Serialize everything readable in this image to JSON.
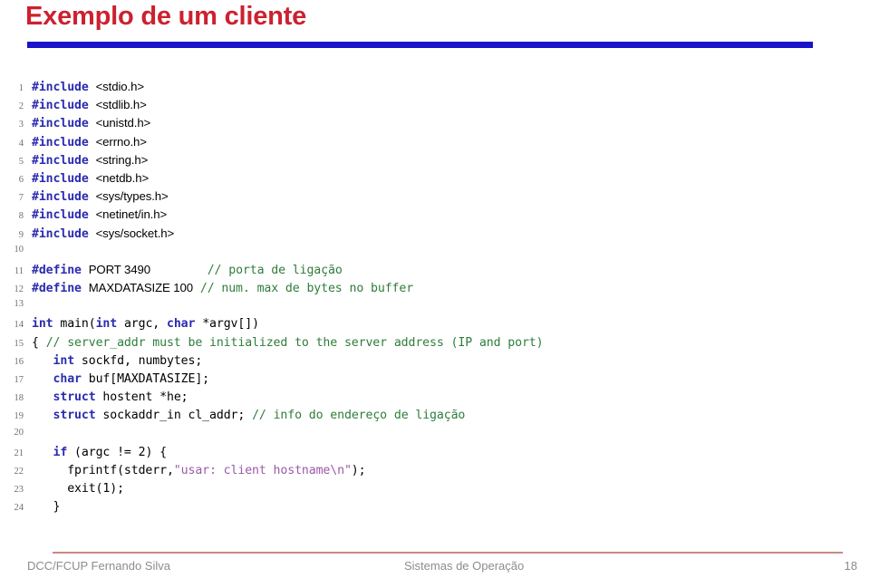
{
  "slide": {
    "title": "Exemplo de um cliente",
    "accent_title_color": "#cc2130",
    "accent_rule_color": "#1a13c8",
    "footer_rule_color": "#c98a83"
  },
  "code": {
    "language": "C",
    "syntax_colors": {
      "keyword": "#2b2bb0",
      "preprocessor": "#2b2bb0",
      "comment": "#2e7d3a",
      "string": "#9a5aa8",
      "plain": "#000000",
      "lineno": "#6f6f6f"
    },
    "lines": [
      {
        "no": "1",
        "tokens": [
          {
            "t": "#include",
            "c": "pre"
          },
          {
            "t": " ",
            "c": "txt"
          },
          {
            "t": "<stdio.h>",
            "c": "sans"
          }
        ]
      },
      {
        "no": "2",
        "tokens": [
          {
            "t": "#include",
            "c": "pre"
          },
          {
            "t": " ",
            "c": "txt"
          },
          {
            "t": "<stdlib.h>",
            "c": "sans"
          }
        ]
      },
      {
        "no": "3",
        "tokens": [
          {
            "t": "#include",
            "c": "pre"
          },
          {
            "t": " ",
            "c": "txt"
          },
          {
            "t": "<unistd.h>",
            "c": "sans"
          }
        ]
      },
      {
        "no": "4",
        "tokens": [
          {
            "t": "#include",
            "c": "pre"
          },
          {
            "t": " ",
            "c": "txt"
          },
          {
            "t": "<errno.h>",
            "c": "sans"
          }
        ]
      },
      {
        "no": "5",
        "tokens": [
          {
            "t": "#include",
            "c": "pre"
          },
          {
            "t": " ",
            "c": "txt"
          },
          {
            "t": "<string.h>",
            "c": "sans"
          }
        ]
      },
      {
        "no": "6",
        "tokens": [
          {
            "t": "#include",
            "c": "pre"
          },
          {
            "t": " ",
            "c": "txt"
          },
          {
            "t": "<netdb.h>",
            "c": "sans"
          }
        ]
      },
      {
        "no": "7",
        "tokens": [
          {
            "t": "#include",
            "c": "pre"
          },
          {
            "t": " ",
            "c": "txt"
          },
          {
            "t": "<sys/types.h>",
            "c": "sans"
          }
        ]
      },
      {
        "no": "8",
        "tokens": [
          {
            "t": "#include",
            "c": "pre"
          },
          {
            "t": " ",
            "c": "txt"
          },
          {
            "t": "<netinet/in.h>",
            "c": "sans"
          }
        ]
      },
      {
        "no": "9",
        "tokens": [
          {
            "t": "#include",
            "c": "pre"
          },
          {
            "t": " ",
            "c": "txt"
          },
          {
            "t": "<sys/socket.h>",
            "c": "sans"
          }
        ]
      },
      {
        "no": "10",
        "tokens": []
      },
      {
        "no": "11",
        "tokens": [
          {
            "t": "#define",
            "c": "pre"
          },
          {
            "t": " ",
            "c": "txt"
          },
          {
            "t": "PORT 3490",
            "c": "sans"
          },
          {
            "t": "        ",
            "c": "txt"
          },
          {
            "t": "// porta de ligação",
            "c": "cmt"
          }
        ]
      },
      {
        "no": "12",
        "tokens": [
          {
            "t": "#define",
            "c": "pre"
          },
          {
            "t": " ",
            "c": "txt"
          },
          {
            "t": "MAXDATASIZE 100",
            "c": "sans"
          },
          {
            "t": " ",
            "c": "txt"
          },
          {
            "t": "// num. max de bytes no buffer",
            "c": "cmt"
          }
        ]
      },
      {
        "no": "13",
        "tokens": []
      },
      {
        "no": "14",
        "tokens": [
          {
            "t": "int",
            "c": "kw"
          },
          {
            "t": " main(",
            "c": "txt"
          },
          {
            "t": "int",
            "c": "kw"
          },
          {
            "t": " argc, ",
            "c": "txt"
          },
          {
            "t": "char",
            "c": "kw"
          },
          {
            "t": " *argv[])",
            "c": "txt"
          }
        ]
      },
      {
        "no": "15",
        "tokens": [
          {
            "t": "{ ",
            "c": "txt"
          },
          {
            "t": "// server_addr must be initialized to the server address (IP and port)",
            "c": "cmt"
          }
        ]
      },
      {
        "no": "16",
        "tokens": [
          {
            "t": "   ",
            "c": "txt"
          },
          {
            "t": "int",
            "c": "kw"
          },
          {
            "t": " sockfd, numbytes;",
            "c": "txt"
          }
        ]
      },
      {
        "no": "17",
        "tokens": [
          {
            "t": "   ",
            "c": "txt"
          },
          {
            "t": "char",
            "c": "kw"
          },
          {
            "t": " buf[MAXDATASIZE];",
            "c": "txt"
          }
        ]
      },
      {
        "no": "18",
        "tokens": [
          {
            "t": "   ",
            "c": "txt"
          },
          {
            "t": "struct",
            "c": "kw"
          },
          {
            "t": " hostent *he;",
            "c": "txt"
          }
        ]
      },
      {
        "no": "19",
        "tokens": [
          {
            "t": "   ",
            "c": "txt"
          },
          {
            "t": "struct",
            "c": "kw"
          },
          {
            "t": " sockaddr_in cl_addr; ",
            "c": "txt"
          },
          {
            "t": "// info do endereço de ligação",
            "c": "cmt"
          }
        ]
      },
      {
        "no": "20",
        "tokens": []
      },
      {
        "no": "21",
        "tokens": [
          {
            "t": "   ",
            "c": "txt"
          },
          {
            "t": "if",
            "c": "kw"
          },
          {
            "t": " (argc != 2) {",
            "c": "txt"
          }
        ]
      },
      {
        "no": "22",
        "tokens": [
          {
            "t": "     fprintf(stderr,",
            "c": "txt"
          },
          {
            "t": "\"usar: client hostname\\n\"",
            "c": "str"
          },
          {
            "t": ");",
            "c": "txt"
          }
        ]
      },
      {
        "no": "23",
        "tokens": [
          {
            "t": "     exit(1);",
            "c": "txt"
          }
        ]
      },
      {
        "no": "24",
        "tokens": [
          {
            "t": "   }",
            "c": "txt"
          }
        ]
      }
    ]
  },
  "footer": {
    "left": "DCC/FCUP Fernando Silva",
    "center": "Sistemas de Operação",
    "page": "18"
  }
}
